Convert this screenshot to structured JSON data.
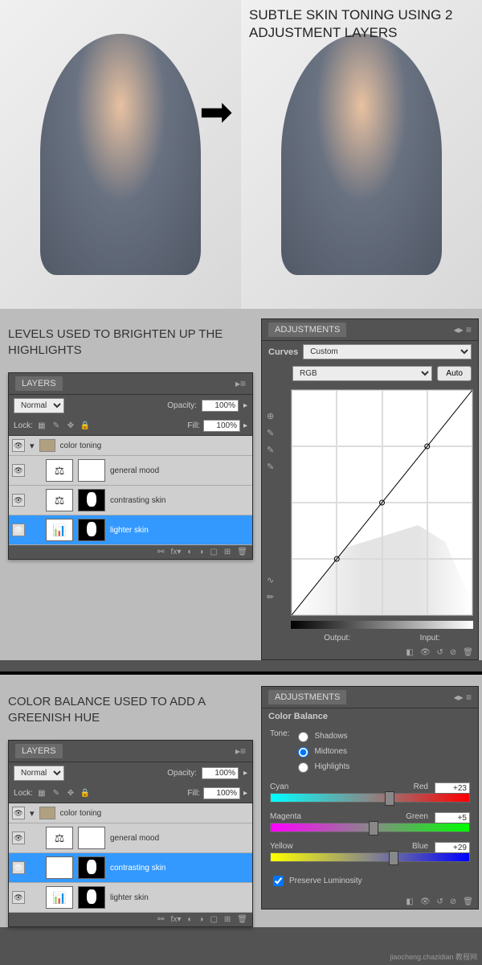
{
  "top_caption": "Subtle skin toning using 2 adjustment layers",
  "section1_heading": "Levels used to brighten up the highlights",
  "section2_heading": "Color balance used to add a greenish hue",
  "layers_panel": {
    "title": "LAYERS",
    "blend_mode": "Normal",
    "opacity_label": "Opacity:",
    "opacity_value": "100%",
    "lock_label": "Lock:",
    "fill_label": "Fill:",
    "fill_value": "100%",
    "folder_name": "color toning",
    "items": [
      {
        "name": "general mood",
        "selected": false,
        "mask": "white"
      },
      {
        "name": "contrasting skin",
        "selected": false,
        "mask": "fig"
      },
      {
        "name": "lighter skin",
        "selected": true,
        "mask": "fig"
      }
    ]
  },
  "layers_panel2": {
    "items": [
      {
        "name": "general mood",
        "selected": false,
        "mask": "white"
      },
      {
        "name": "contrasting skin",
        "selected": true,
        "mask": "fig"
      },
      {
        "name": "lighter skin",
        "selected": false,
        "mask": "fig"
      }
    ]
  },
  "adjustments_panel": {
    "title": "ADJUSTMENTS",
    "curves_label": "Curves",
    "preset": "Custom",
    "channel": "RGB",
    "auto_label": "Auto",
    "output_label": "Output:",
    "input_label": "Input:"
  },
  "color_balance": {
    "title": "Color Balance",
    "tone_label": "Tone:",
    "tones": [
      "Shadows",
      "Midtones",
      "Highlights"
    ],
    "tone_selected": "Midtones",
    "sliders": [
      {
        "left": "Cyan",
        "right": "Red",
        "value": "+23",
        "pos": 60
      },
      {
        "left": "Magenta",
        "right": "Green",
        "value": "+5",
        "pos": 52
      },
      {
        "left": "Yellow",
        "right": "Blue",
        "value": "+29",
        "pos": 62
      }
    ],
    "preserve_label": "Preserve Luminosity",
    "preserve_checked": true
  },
  "watermark": "jiaocheng.chazidian 教程网",
  "chart_data": {
    "type": "line",
    "title": "Curves",
    "xlabel": "Input",
    "ylabel": "Output",
    "xlim": [
      0,
      255
    ],
    "ylim": [
      0,
      255
    ],
    "series": [
      {
        "name": "RGB",
        "x": [
          0,
          64,
          128,
          192,
          255
        ],
        "y": [
          0,
          60,
          128,
          195,
          255
        ]
      }
    ]
  }
}
